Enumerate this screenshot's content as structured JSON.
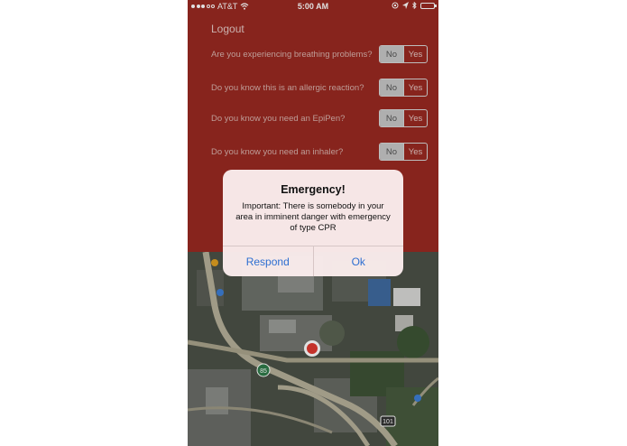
{
  "status_bar": {
    "carrier": "AT&T",
    "time": "5:00 AM",
    "signal_icon": "signal-dots-icon",
    "wifi_icon": "wifi-icon",
    "bluetooth_icon": "bluetooth-icon",
    "battery_icon": "battery-icon"
  },
  "header": {
    "logout_label": "Logout"
  },
  "questions": [
    {
      "text": "Are you experiencing breathing problems?",
      "no": "No",
      "yes": "Yes",
      "selected": "No"
    },
    {
      "text": "Do you know this is an allergic reaction?",
      "no": "No",
      "yes": "Yes",
      "selected": "No"
    },
    {
      "text": "Do you know you need an EpiPen?",
      "no": "No",
      "yes": "Yes",
      "selected": "No"
    },
    {
      "text": "Do you know you need an inhaler?",
      "no": "No",
      "yes": "Yes",
      "selected": "No"
    }
  ],
  "map": {
    "highway_labels": [
      "85",
      "101"
    ],
    "location_icon": "current-location-icon"
  },
  "alert": {
    "title": "Emergency!",
    "message": "Important: There is somebody in your area in imminent danger with emergency of type CPR",
    "respond_label": "Respond",
    "ok_label": "Ok"
  },
  "colors": {
    "background": "#9a2a22",
    "alert_button_text": "#2e6fd1",
    "location_marker": "#e03a30"
  }
}
